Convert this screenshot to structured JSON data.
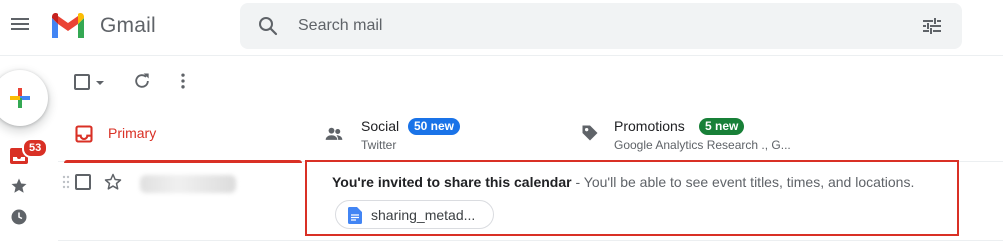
{
  "app": {
    "brand": "Gmail",
    "icons": {
      "menu": "menu-icon",
      "logo": "gmail-logo-icon",
      "search": "search-icon",
      "tune": "tune-icon"
    }
  },
  "search": {
    "placeholder": "Search mail"
  },
  "rail": {
    "inbox_count": "53",
    "icons": [
      "compose-icon",
      "inbox-icon",
      "star-icon",
      "clock-icon"
    ]
  },
  "tabs": [
    {
      "label": "Primary",
      "icon": "inbox-icon",
      "active": true
    },
    {
      "label": "Social",
      "badge": "50 new",
      "sub": "Twitter",
      "icon": "people-icon"
    },
    {
      "label": "Promotions",
      "badge": "5 new",
      "sub": "Google Analytics Research ., G...",
      "icon": "tag-icon"
    }
  ],
  "email": {
    "subject": "You're invited to share this calendar",
    "snippet": " - You'll be able to see event titles, times, and locations.",
    "attachment": "sharing_metad..."
  },
  "colors": {
    "accent_red": "#d93025",
    "social_blue": "#1a73e8",
    "promo_green": "#188038"
  }
}
